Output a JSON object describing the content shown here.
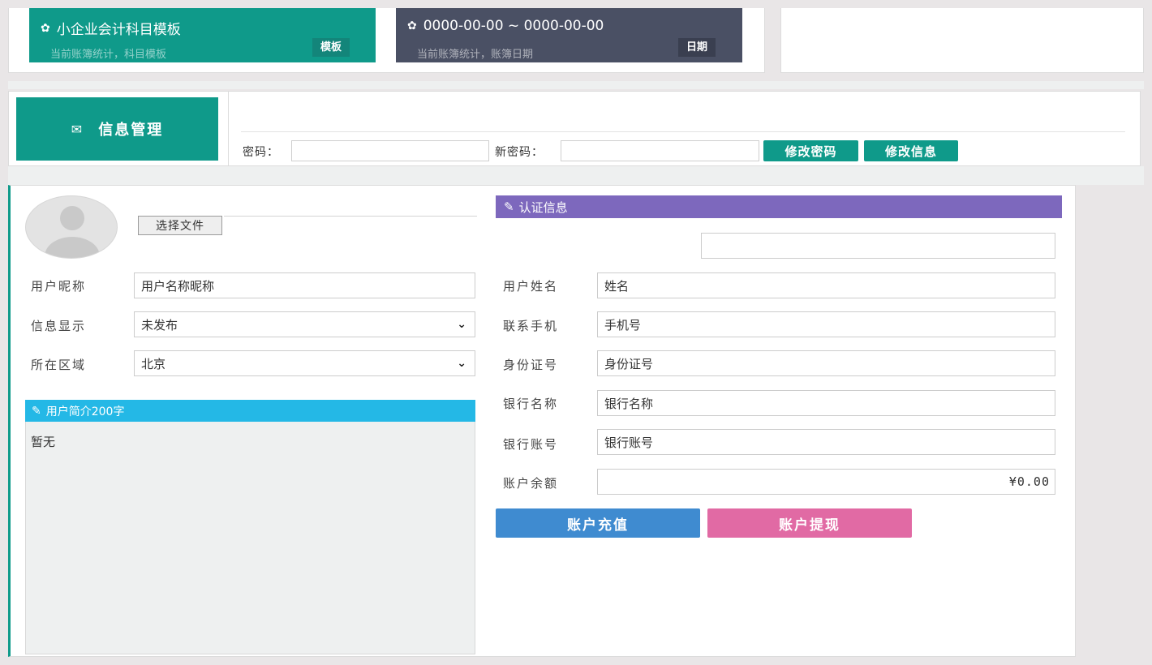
{
  "cards": {
    "template": {
      "title": "小企业会计科目模板",
      "subtitle": "当前账簿统计，科目模板",
      "tag": "模板",
      "color": "#0f9a8a"
    },
    "date": {
      "title": "0000-00-00 ~ 0000-00-00",
      "subtitle": "当前账簿统计，账簿日期",
      "tag": "日期",
      "color": "#4a5064"
    }
  },
  "info_bar": {
    "tile_label": "信息管理",
    "tile_icon": "envelope-icon",
    "password_label": "密码：",
    "new_password_label": "新密码：",
    "password_value": "",
    "new_password_value": "",
    "change_password_button": "修改密码",
    "change_info_button": "修改信息"
  },
  "profile": {
    "file_button": "选择文件",
    "nickname_label": "用户昵称",
    "nickname_value": "用户名称昵称",
    "display_label": "信息显示",
    "display_value": "未发布",
    "region_label": "所在区域",
    "region_value": "北京",
    "intro_title": "用户简介200字",
    "intro_text": "暂无"
  },
  "certification": {
    "title": "认证信息",
    "title_color": "#7d68bd",
    "name_label": "用户姓名",
    "name_value": "姓名",
    "phone_label": "联系手机",
    "phone_value": "手机号",
    "id_label": "身份证号",
    "id_value": "身份证号",
    "bank_name_label": "银行名称",
    "bank_name_value": "银行名称",
    "bank_account_label": "银行账号",
    "bank_account_value": "银行账号",
    "balance_label": "账户余额",
    "balance_value": "¥0.00",
    "recharge_button": "账户充值",
    "withdraw_button": "账户提现"
  }
}
